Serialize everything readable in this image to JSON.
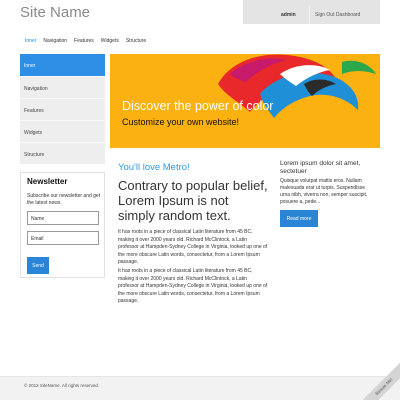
{
  "site": {
    "name": "Site Name"
  },
  "user": {
    "name": "admin",
    "signout": "Sign Out Dashboard"
  },
  "topnav": {
    "items": [
      {
        "label": "Inner"
      },
      {
        "label": "Navigation"
      },
      {
        "label": "Features"
      },
      {
        "label": "Widgets"
      },
      {
        "label": "Structure"
      }
    ]
  },
  "sidebar": {
    "items": [
      {
        "label": "Inner"
      },
      {
        "label": "Navigation"
      },
      {
        "label": "Features"
      },
      {
        "label": "Widgets"
      },
      {
        "label": "Structure"
      }
    ]
  },
  "newsletter": {
    "title": "Newsletter",
    "text": "Subscribe our newsletter and get the latest news.",
    "name_placeholder": "Name",
    "email_placeholder": "Email",
    "send_label": "Send"
  },
  "banner": {
    "line1": "Discover the power of color",
    "line2": "Customize your own website!"
  },
  "main": {
    "subtitle": "You'll love Metro!",
    "heading": "Contrary to popular belief, Lorem Ipsum is not simply random text.",
    "paragraph1": "It has roots in a piece of classical Latin literature from 45 BC, making it over 2000 years old. Richard McClintock, a Latin professor at Hampden-Sydney College in Virginia, looked up one of the more obscure Latin words, consectetur, from a Lorem Ipsum passage.",
    "paragraph2": "It has roots in a piece of classical Latin literature from 45 BC, making it over 2000 years old. Richard McClintock, a Latin professor at Hampden-Sydney College in Virginia, looked up one of the more obscure Latin words, consectetur, from a Lorem Ipsum passage."
  },
  "aside": {
    "title": "Lorem ipsum dolor sit amet, sectetuer",
    "text": "Quisque volutpat mattis eros. Nullam malesuada erat ut turpis. Suspendisse urna nibh, viverra non, semper suscipit, posuere a, pede...",
    "read_more": "Read more"
  },
  "footer": {
    "text": "© 2012 SiteName. All rights reserved."
  },
  "resize": {
    "label": "Resize Me!"
  },
  "colors": {
    "accent": "#2f8ee5",
    "banner_bg": "#fbb10f",
    "subtitle": "#2f9ae8"
  }
}
